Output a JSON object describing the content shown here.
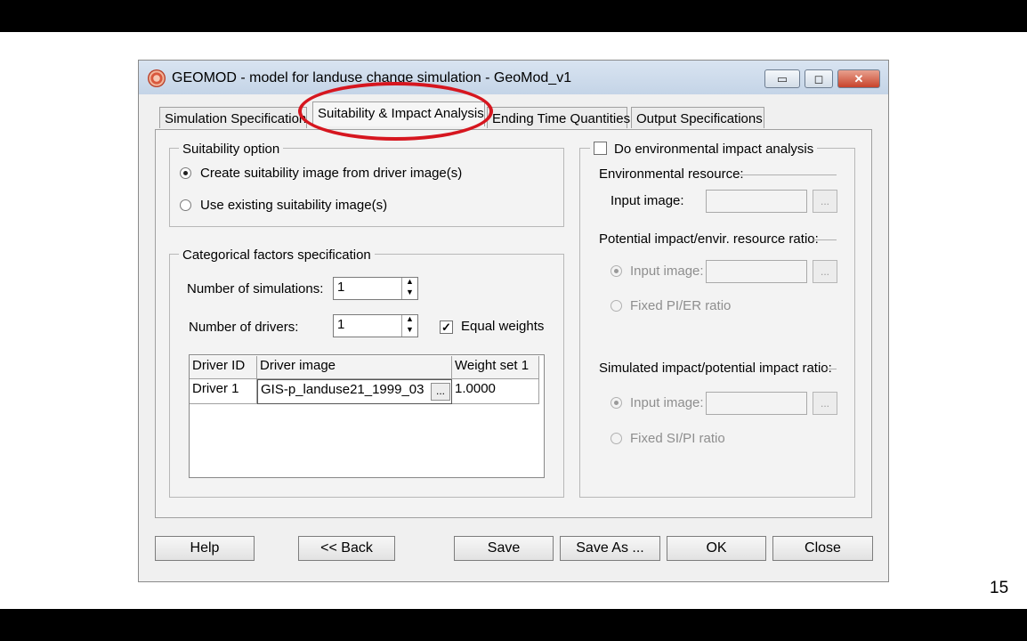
{
  "window": {
    "title": "GEOMOD - model for landuse change simulation - GeoMod_v1",
    "controls": {
      "minimize": "▭",
      "maximize": "◻",
      "close": "✕"
    }
  },
  "tabs": [
    {
      "label": "Simulation Specification"
    },
    {
      "label": "Suitability & Impact Analysis",
      "active": true
    },
    {
      "label": "Ending Time Quantities"
    },
    {
      "label": "Output Specifications"
    }
  ],
  "suitability": {
    "legend": "Suitability option",
    "option_driver": "Create suitability image from driver image(s)",
    "option_existing": "Use existing suitability image(s)",
    "selected": "driver"
  },
  "categorical": {
    "legend": "Categorical factors specification",
    "num_simulations_label": "Number of simulations:",
    "num_simulations": "1",
    "num_drivers_label": "Number of drivers:",
    "num_drivers": "1",
    "equal_weights_label": "Equal weights",
    "equal_weights_checked": true,
    "table": {
      "headers": [
        "Driver ID",
        "Driver image",
        "Weight set 1"
      ],
      "rows": [
        {
          "driver_id": "Driver 1",
          "driver_image": "GIS-p_landuse21_1999_03",
          "weight": "1.0000"
        }
      ],
      "browse_label": "..."
    }
  },
  "impact": {
    "legend": "Do environmental impact analysis",
    "checked": false,
    "env_resource_label": "Environmental resource:",
    "input_image_label": "Input image:",
    "pi_er_label": "Potential impact/envir. resource ratio:",
    "pi_input_label": "Input image:",
    "pi_fixed_label": "Fixed PI/ER ratio",
    "si_pi_label": "Simulated impact/potential impact ratio:",
    "si_input_label": "Input image:",
    "si_fixed_label": "Fixed SI/PI ratio",
    "browse_label": "..."
  },
  "buttons": {
    "help": "Help",
    "back": "<< Back",
    "save": "Save",
    "save_as": "Save As ...",
    "ok": "OK",
    "close": "Close"
  },
  "slide": {
    "page_number": "15"
  },
  "colors": {
    "highlight": "#d6161f"
  }
}
